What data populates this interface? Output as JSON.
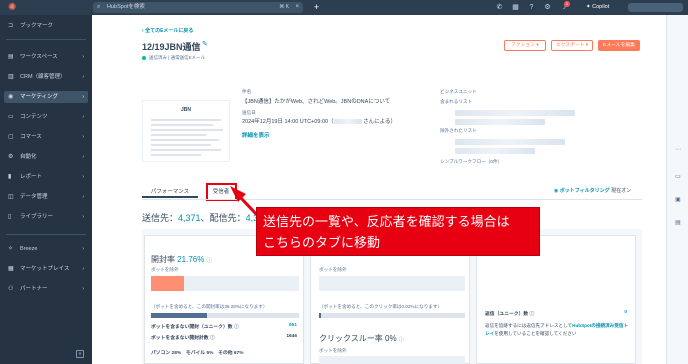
{
  "topbar": {
    "search_placeholder": "HubSpotを検索",
    "search_shortcut": "⌘ K",
    "notification_count": "1",
    "copilot_label": "Copilot"
  },
  "sidebar": {
    "items": [
      {
        "label": "ブックマーク",
        "icon": "bookmark-icon"
      },
      {
        "label": "ワークスペース",
        "icon": "workspace-icon"
      },
      {
        "label": "CRM（顧客管理）",
        "icon": "crm-icon"
      },
      {
        "label": "マーケティング",
        "icon": "marketing-icon"
      },
      {
        "label": "コンテンツ",
        "icon": "content-icon"
      },
      {
        "label": "コマース",
        "icon": "commerce-icon"
      },
      {
        "label": "自動化",
        "icon": "automation-icon"
      },
      {
        "label": "レポート",
        "icon": "reports-icon"
      },
      {
        "label": "データ管理",
        "icon": "data-icon"
      },
      {
        "label": "ライブラリー",
        "icon": "library-icon"
      },
      {
        "label": "Breeze",
        "icon": "breeze-icon"
      },
      {
        "label": "マーケットプレイス",
        "icon": "marketplace-icon"
      },
      {
        "label": "パートナー",
        "icon": "partner-icon"
      }
    ],
    "active_index": 3
  },
  "email": {
    "back_link": "全てのEメールに戻る",
    "title": "12/19JBN通信",
    "status": "送信済み | 通常送信Eメール",
    "actions": {
      "action": "アクション ▾",
      "export": "エクスポート ▾",
      "edit": "Eメールを編集"
    },
    "preview_logo": "JBN",
    "subject_label": "件名",
    "subject_value": "【JBN通信】たかがWeb、されどWeb。JBNのDNAについて",
    "sent_label": "送信日",
    "sent_value_prefix": "2024年12月19日 14:00 UTC+09:00（",
    "sent_value_suffix": "さんによる）",
    "details_link": "詳細を表示",
    "business_unit_label": "ビジネスユニット",
    "included_lists_label": "含まれるリスト",
    "excluded_lists_label": "除外されたリスト",
    "simple_workflow_label": "シンプルワークフロー（0件）"
  },
  "tabs": {
    "performance": "パフォーマンス",
    "recipients": "受信者",
    "smart_filter_label": "ボットフィルタリング",
    "smart_filter_state": "現在オン"
  },
  "counts": {
    "sent_label": "送信先：",
    "sent_value": "4,371",
    "delivered_label": "配信先：",
    "delivered_value": "4,3"
  },
  "cards": {
    "open": {
      "title": "開封率",
      "rate": "21.76%",
      "bot_excluded": "ボットを除外",
      "bot_excluded_share": 0.22,
      "bot_included_note": "（ボットを含めると、この開封率は38.28%になります）",
      "bot_included_share": 0.38,
      "unique_opens_label": "ボットを含まない開封（ユニーク）数",
      "unique_opens_value": "951",
      "total_opens_label": "ボットを含まない開封計数",
      "total_opens_value": "1646",
      "devices": "パソコン 28%　モバイル 5%　その他 67%"
    },
    "click": {
      "bot_excluded": "ボットを除外",
      "bot_included_note": "（ボットを含めると、このクリック率は0.02%になります）",
      "ctr_title": "クリックスルー率",
      "ctr_value": "0%",
      "ctr_bot_excluded": "ボットを除外"
    },
    "reply": {
      "label": "返信（ユニーク）数",
      "value": "0",
      "help_prefix": "返信を追跡するには返信先アドレスとして",
      "help_link": "HubSpotの接続済み受信トレイ",
      "help_suffix": "を使用していることを確認してください"
    }
  },
  "annotation": {
    "line1": "送信先の一覧や、反応者を確認する場合は",
    "line2": "こちらのタブに移動"
  },
  "colors": {
    "accent": "#ff7a59",
    "link": "#0091ae",
    "annotation": "#e60012",
    "nav_bg": "#253342"
  }
}
